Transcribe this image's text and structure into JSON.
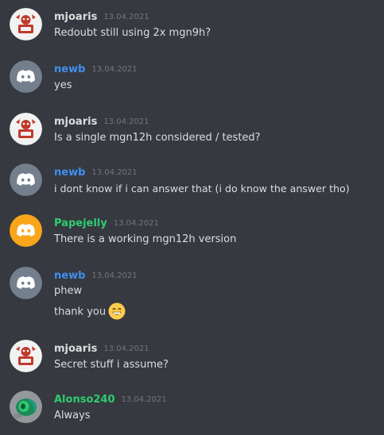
{
  "colors": {
    "background": "#36393f",
    "mjoaris_name": "#dcddde",
    "newb_name": "#3f8ff0",
    "papejelly_name": "#2ecc71",
    "alonso_name": "#2ecc71",
    "message_text": "#dcddde",
    "timestamp": "#72767d",
    "discord_gray_avatar": "#747f8d",
    "discord_orange_avatar": "#faa61a"
  },
  "messages": [
    {
      "username": "mjoaris",
      "timestamp": "13.04.2021",
      "avatar_icon": "mjoaris-avatar",
      "lines": [
        "Redoubt still using 2x mgn9h?"
      ]
    },
    {
      "username": "newb",
      "timestamp": "13.04.2021",
      "avatar_icon": "discord-default-avatar-gray",
      "lines": [
        "yes"
      ]
    },
    {
      "username": "mjoaris",
      "timestamp": "13.04.2021",
      "avatar_icon": "mjoaris-avatar",
      "lines": [
        "Is a single mgn12h considered / tested?"
      ]
    },
    {
      "username": "newb",
      "timestamp": "13.04.2021",
      "avatar_icon": "discord-default-avatar-gray",
      "lines": [
        "i dont know if i can answer that (i do know the answer tho)"
      ]
    },
    {
      "username": "Papejelly",
      "timestamp": "13.04.2021",
      "avatar_icon": "discord-default-avatar-orange",
      "lines": [
        "There is a working mgn12h version"
      ]
    },
    {
      "username": "newb",
      "timestamp": "13.04.2021",
      "avatar_icon": "discord-default-avatar-gray",
      "lines": [
        "phew",
        "thank you"
      ],
      "emoji": "grinning-face-emoji"
    },
    {
      "username": "mjoaris",
      "timestamp": "13.04.2021",
      "avatar_icon": "mjoaris-avatar",
      "lines": [
        "Secret stuff i assume?"
      ]
    },
    {
      "username": "Alonso240",
      "timestamp": "13.04.2021",
      "avatar_icon": "alonso-avatar",
      "lines": [
        "Always"
      ]
    }
  ]
}
